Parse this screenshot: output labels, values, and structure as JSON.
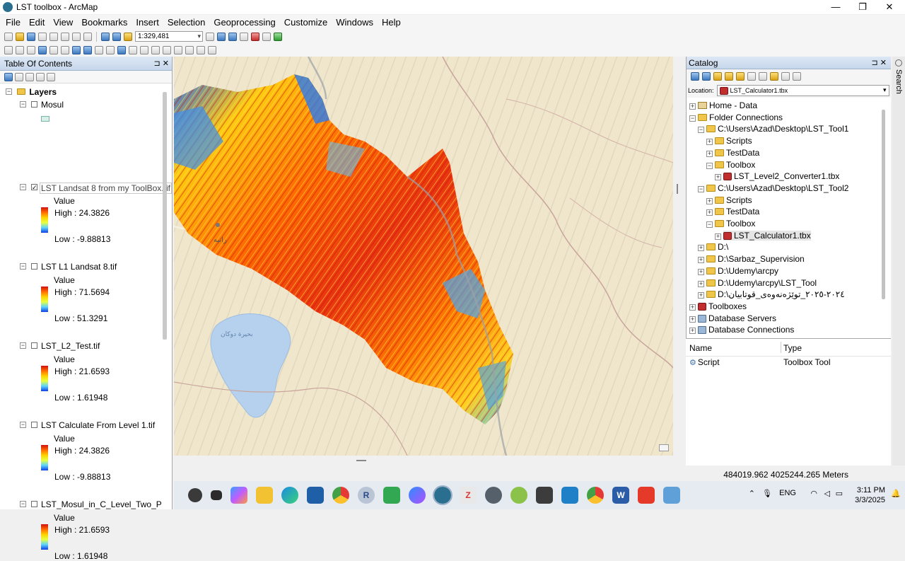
{
  "window": {
    "title": "LST toolbox - ArcMap"
  },
  "menu": [
    "File",
    "Edit",
    "View",
    "Bookmarks",
    "Insert",
    "Selection",
    "Geoprocessing",
    "Customize",
    "Windows",
    "Help"
  ],
  "toolbar": {
    "scale": "1:329,481"
  },
  "toc": {
    "title": "Table Of Contents",
    "root": "Layers",
    "layers": [
      {
        "name": "Mosul",
        "checked": false
      },
      {
        "name": "LST Landsat 8 from my ToolBox.tif",
        "checked": true,
        "value_label": "Value",
        "high": "High : 24.3826",
        "low": "Low : -9.88813"
      },
      {
        "name": "LST L1 Landsat 8.tif",
        "checked": false,
        "value_label": "Value",
        "high": "High : 71.5694",
        "low": "Low : 51.3291"
      },
      {
        "name": "LST_L2_Test.tif",
        "checked": false,
        "value_label": "Value",
        "high": "High : 21.6593",
        "low": "Low : 1.61948"
      },
      {
        "name": "LST Calculate From Level 1.tif",
        "checked": false,
        "value_label": "Value",
        "high": "High : 24.3826",
        "low": "Low : -9.88813"
      },
      {
        "name": "LST_Mosul_in_C_Level_Two_Prod",
        "checked": false,
        "value_label": "Value",
        "high": "High : 21.6593",
        "low": "Low : 1.61948"
      }
    ]
  },
  "catalog": {
    "title": "Catalog",
    "location_label": "Location:",
    "location_value": "LST_Calculator1.tbx",
    "tree": [
      {
        "label": "Home - Data",
        "level": 0,
        "icon": "home",
        "exp": "+"
      },
      {
        "label": "Folder Connections",
        "level": 0,
        "icon": "folder",
        "exp": "−"
      },
      {
        "label": "C:\\Users\\Azad\\Desktop\\LST_Tool1",
        "level": 1,
        "icon": "folder",
        "exp": "−"
      },
      {
        "label": "Scripts",
        "level": 2,
        "icon": "folder",
        "exp": "+"
      },
      {
        "label": "TestData",
        "level": 2,
        "icon": "folder",
        "exp": "+"
      },
      {
        "label": "Toolbox",
        "level": 2,
        "icon": "folder",
        "exp": "−"
      },
      {
        "label": "LST_Level2_Converter1.tbx",
        "level": 3,
        "icon": "toolbox",
        "exp": "+"
      },
      {
        "label": "C:\\Users\\Azad\\Desktop\\LST_Tool2",
        "level": 1,
        "icon": "folder",
        "exp": "−"
      },
      {
        "label": "Scripts",
        "level": 2,
        "icon": "folder",
        "exp": "+"
      },
      {
        "label": "TestData",
        "level": 2,
        "icon": "folder",
        "exp": "+"
      },
      {
        "label": "Toolbox",
        "level": 2,
        "icon": "folder",
        "exp": "−"
      },
      {
        "label": "LST_Calculator1.tbx",
        "level": 3,
        "icon": "toolbox",
        "exp": "+",
        "selected": true
      },
      {
        "label": "D:\\",
        "level": 1,
        "icon": "folder",
        "exp": "+"
      },
      {
        "label": "D:\\Sarbaz_Supervision",
        "level": 1,
        "icon": "folder",
        "exp": "+"
      },
      {
        "label": "D:\\Udemy\\arcpy",
        "level": 1,
        "icon": "folder",
        "exp": "+"
      },
      {
        "label": "D:\\Udemy\\arcpy\\LST_Tool",
        "level": 1,
        "icon": "folder",
        "exp": "+"
      },
      {
        "label": "D:\\٢٠٢٤-٢٠٢٥_توێژەنەوەی_قوتابیان",
        "level": 1,
        "icon": "folder",
        "exp": "+"
      },
      {
        "label": "Toolboxes",
        "level": 0,
        "icon": "toolbox",
        "exp": "+"
      },
      {
        "label": "Database Servers",
        "level": 0,
        "icon": "server",
        "exp": "+"
      },
      {
        "label": "Database Connections",
        "level": 0,
        "icon": "server",
        "exp": "+"
      }
    ],
    "list_headers": {
      "name": "Name",
      "type": "Type"
    },
    "list_rows": [
      {
        "name": "Script",
        "type": "Toolbox Tool"
      }
    ]
  },
  "search_tab": "Search",
  "status": {
    "coords": "484019.962  4025244.265 Meters"
  },
  "map_labels": {
    "city": "رانیه",
    "lake": "بحيرة دوكان"
  },
  "taskbar": {
    "lang": "ENG",
    "time": "3:11 PM",
    "date": "3/3/2025"
  },
  "colors": {
    "lst_high": "#d01010",
    "lst_low": "#1040e0",
    "panel_header": "#c6d6ea"
  }
}
